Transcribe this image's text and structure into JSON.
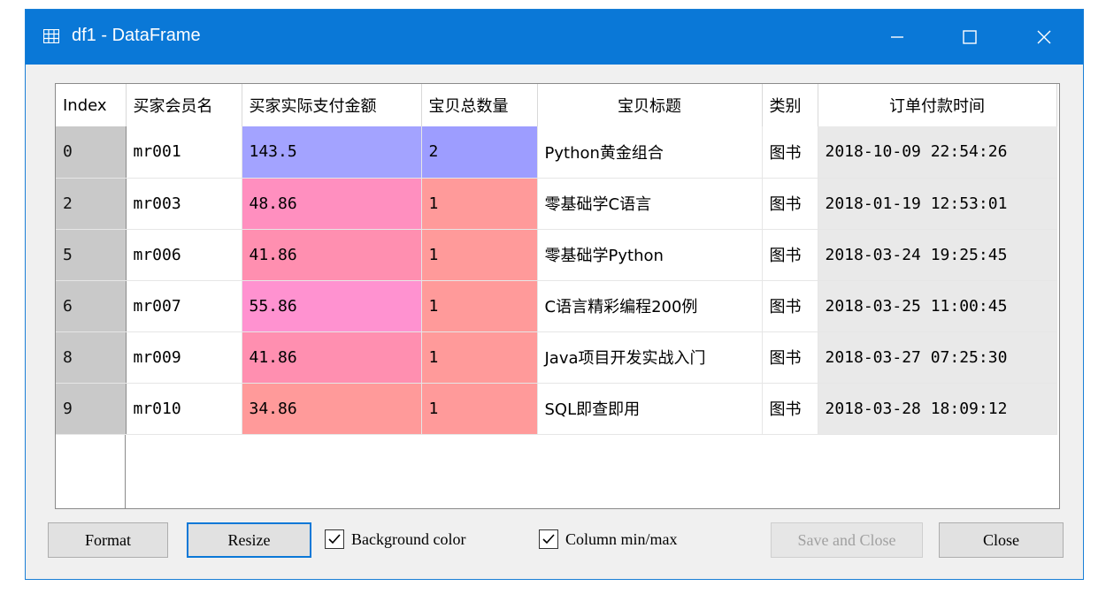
{
  "window": {
    "title": "df1 - DataFrame"
  },
  "table": {
    "headers": [
      "Index",
      "买家会员名",
      "买家实际支付金额",
      "宝贝总数量",
      "宝贝标题",
      "类别",
      "订单付款时间"
    ],
    "rows": [
      {
        "index": "0",
        "member": "mr001",
        "amount": "143.5",
        "count": "2",
        "title": "Python黄金组合",
        "category": "图书",
        "time": "2018-10-09 22:54:26",
        "amount_color": "#a3a3ff",
        "count_color": "#9d9dff"
      },
      {
        "index": "2",
        "member": "mr003",
        "amount": "48.86",
        "count": "1",
        "title": "零基础学C语言",
        "category": "图书",
        "time": "2018-01-19 12:53:01",
        "amount_color": "#ff8fbf",
        "count_color": "#ff9a9a"
      },
      {
        "index": "5",
        "member": "mr006",
        "amount": "41.86",
        "count": "1",
        "title": "零基础学Python",
        "category": "图书",
        "time": "2018-03-24 19:25:45",
        "amount_color": "#ff8fb0",
        "count_color": "#ff9a9a"
      },
      {
        "index": "6",
        "member": "mr007",
        "amount": "55.86",
        "count": "1",
        "title": "C语言精彩编程200例",
        "category": "图书",
        "time": "2018-03-25 11:00:45",
        "amount_color": "#ff92d0",
        "count_color": "#ff9a9a"
      },
      {
        "index": "8",
        "member": "mr009",
        "amount": "41.86",
        "count": "1",
        "title": "Java项目开发实战入门",
        "category": "图书",
        "time": "2018-03-27 07:25:30",
        "amount_color": "#ff8fb0",
        "count_color": "#ff9a9a"
      },
      {
        "index": "9",
        "member": "mr010",
        "amount": "34.86",
        "count": "1",
        "title": "SQL即查即用",
        "category": "图书",
        "time": "2018-03-28 18:09:12",
        "amount_color": "#ff9a9a",
        "count_color": "#ff9a9a"
      }
    ]
  },
  "buttons": {
    "format": "Format",
    "resize": "Resize",
    "save_close": "Save and Close",
    "close": "Close"
  },
  "checkboxes": {
    "background_color": {
      "label": "Background color",
      "checked": true
    },
    "column_minmax": {
      "label": "Column min/max",
      "checked": true
    }
  },
  "icons": {
    "title": "table-icon",
    "minimize": "minimize-icon",
    "maximize": "maximize-icon",
    "close": "close-icon",
    "checkbox": "checkmark-icon"
  },
  "colors": {
    "titlebar": "#0a78d7",
    "index_bg": "#c9c9c9",
    "date_bg": "#e9e9e9"
  }
}
